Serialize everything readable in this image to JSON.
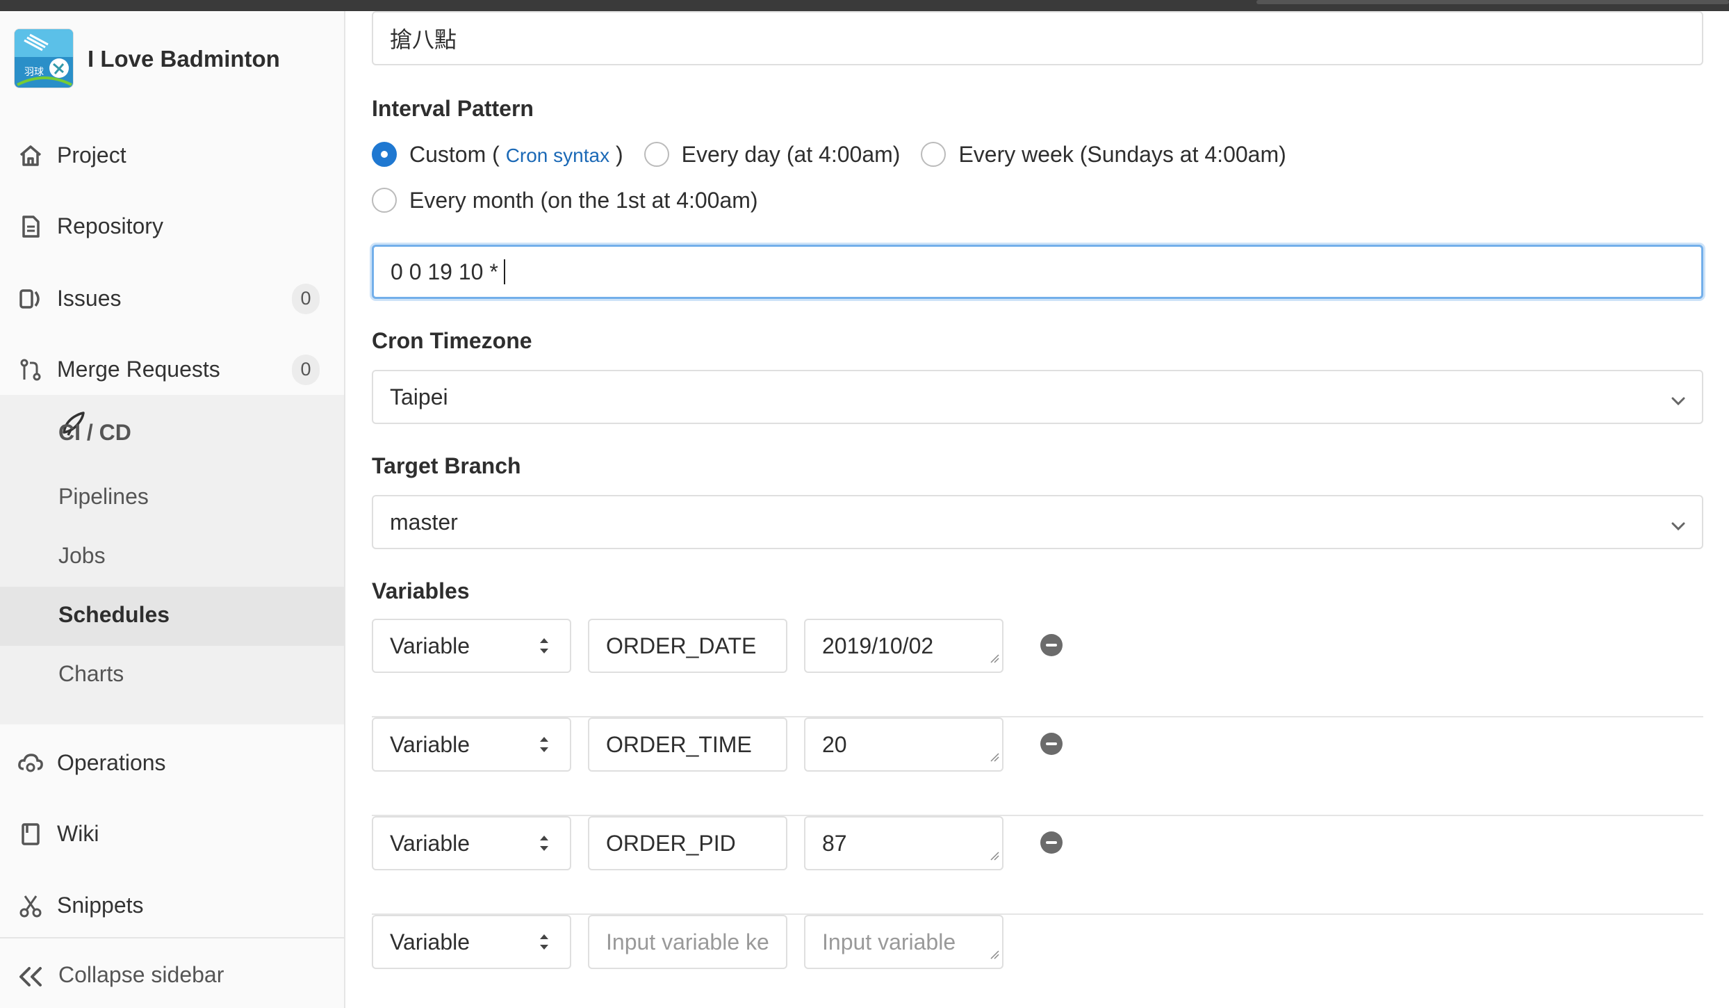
{
  "project": {
    "name": "I Love Badminton",
    "avatar_text": "羽球"
  },
  "sidebar": {
    "items": [
      {
        "label": "Project",
        "icon": "home-icon"
      },
      {
        "label": "Repository",
        "icon": "document-icon"
      },
      {
        "label": "Issues",
        "icon": "issues-icon",
        "badge": "0"
      },
      {
        "label": "Merge Requests",
        "icon": "merge-request-icon",
        "badge": "0"
      }
    ],
    "cicd": {
      "label": "CI / CD",
      "icon": "rocket-icon",
      "subitems": [
        "Pipelines",
        "Jobs",
        "Schedules",
        "Charts"
      ],
      "active": "Schedules"
    },
    "items_after": [
      {
        "label": "Operations",
        "icon": "cloud-gear-icon"
      },
      {
        "label": "Wiki",
        "icon": "book-icon"
      },
      {
        "label": "Snippets",
        "icon": "scissors-icon"
      }
    ],
    "collapse_label": "Collapse sidebar"
  },
  "form": {
    "description_value": "搶八點",
    "interval": {
      "label": "Interval Pattern",
      "options": {
        "custom": "Custom (",
        "cron_link": "Cron syntax",
        "custom_close": ")",
        "daily": "Every day (at 4:00am)",
        "weekly": "Every week (Sundays at 4:00am)",
        "monthly": "Every month (on the 1st at 4:00am)"
      },
      "selected": "custom",
      "cron_value": "0 0 19 10 *"
    },
    "timezone": {
      "label": "Cron Timezone",
      "value": "Taipei"
    },
    "branch": {
      "label": "Target Branch",
      "value": "master"
    },
    "variables": {
      "label": "Variables",
      "rows": [
        {
          "type": "Variable",
          "key": "ORDER_DATE",
          "value": "2019/10/02"
        },
        {
          "type": "Variable",
          "key": "ORDER_TIME",
          "value": "20"
        },
        {
          "type": "Variable",
          "key": "ORDER_PID",
          "value": "87"
        }
      ],
      "empty_row": {
        "type": "Variable",
        "key_placeholder": "Input variable ke",
        "value_placeholder": "Input variable"
      }
    }
  },
  "colors": {
    "accent": "#1f78d1",
    "focus": "#73afea",
    "link": "#1b69b6"
  }
}
